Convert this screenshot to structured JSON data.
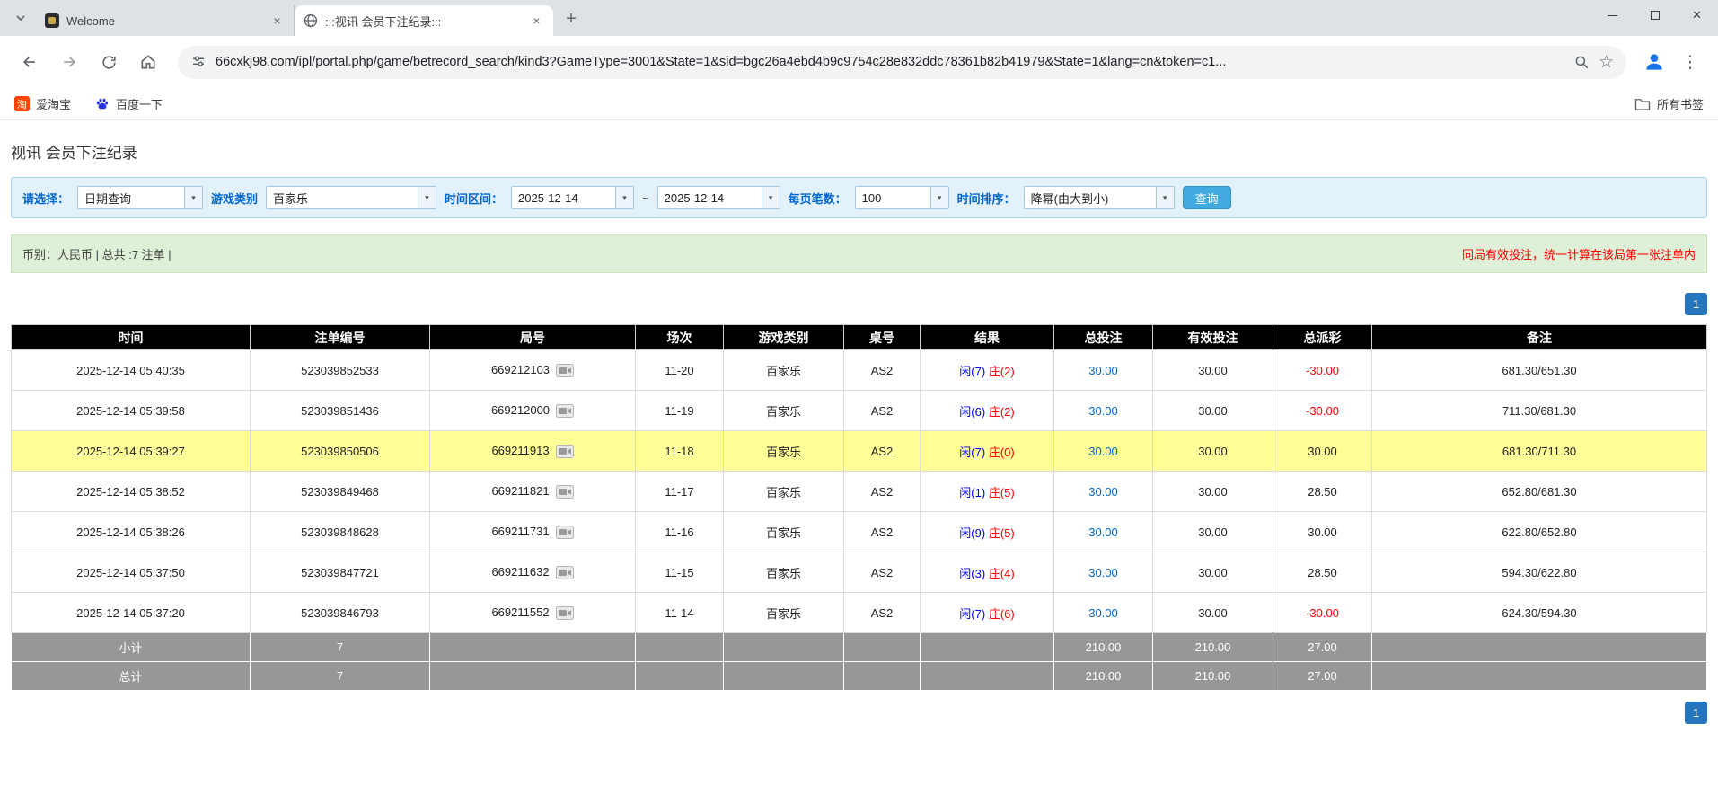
{
  "colors": {
    "accent_blue": "#0066cc",
    "negative_red": "#ff0000",
    "highlight_yellow": "#ffff99",
    "player_blue": "#0000ff",
    "banker_red": "#ff0000"
  },
  "icons": {
    "star": "☆",
    "menu": "⋮",
    "new_tab": "+",
    "close": "×",
    "window_close": "✕",
    "dropdown_arrow": "▾",
    "taobao_glyph": "淘"
  },
  "browser": {
    "tabs": [
      {
        "title": "Welcome"
      },
      {
        "title": ":::视讯 会员下注纪录:::"
      }
    ],
    "url": "66cxkj98.com/ipl/portal.php/game/betrecord_search/kind3?GameType=3001&State=1&sid=bgc26a4ebd4b9c9754c28e832ddc78361b82b41979&State=1&lang=cn&token=c1...",
    "bookmarks": [
      {
        "label": "爱淘宝"
      },
      {
        "label": "百度一下"
      }
    ],
    "all_bookmarks_label": "所有书签"
  },
  "page": {
    "title": "视讯 会员下注纪录",
    "filters": {
      "select_label": "请选择：",
      "select_value": "日期查询",
      "game_type_label": "游戏类别",
      "game_type_value": "百家乐",
      "date_range_label": "时间区间：",
      "date_from": "2025-12-14",
      "date_separator": "~",
      "date_to": "2025-12-14",
      "page_size_label": "每页笔数：",
      "page_size_value": "100",
      "sort_label": "时间排序：",
      "sort_value": "降幂(由大到小)",
      "search_button": "查询"
    },
    "info_bar": {
      "left": "币别：人民币 | 总共 :7 注单 |",
      "right": "同局有效投注，统一计算在该局第一张注单内"
    },
    "pagination": "1",
    "table": {
      "headers": [
        "时间",
        "注单编号",
        "局号",
        "场次",
        "游戏类别",
        "桌号",
        "结果",
        "总投注",
        "有效投注",
        "总派彩",
        "备注"
      ],
      "rows": [
        {
          "time": "2025-12-14 05:40:35",
          "bet_id": "523039852533",
          "round": "669212103",
          "session": "11-20",
          "game": "百家乐",
          "table_no": "AS2",
          "result_player": "闲(7)",
          "result_banker": "庄(2)",
          "total_bet": "30.00",
          "valid_bet": "30.00",
          "payout": "-30.00",
          "remark": "681.30/651.30",
          "highlighted": false
        },
        {
          "time": "2025-12-14 05:39:58",
          "bet_id": "523039851436",
          "round": "669212000",
          "session": "11-19",
          "game": "百家乐",
          "table_no": "AS2",
          "result_player": "闲(6)",
          "result_banker": "庄(2)",
          "total_bet": "30.00",
          "valid_bet": "30.00",
          "payout": "-30.00",
          "remark": "711.30/681.30",
          "highlighted": false
        },
        {
          "time": "2025-12-14 05:39:27",
          "bet_id": "523039850506",
          "round": "669211913",
          "session": "11-18",
          "game": "百家乐",
          "table_no": "AS2",
          "result_player": "闲(7)",
          "result_banker": "庄(0)",
          "total_bet": "30.00",
          "valid_bet": "30.00",
          "payout": "30.00",
          "remark": "681.30/711.30",
          "highlighted": true
        },
        {
          "time": "2025-12-14 05:38:52",
          "bet_id": "523039849468",
          "round": "669211821",
          "session": "11-17",
          "game": "百家乐",
          "table_no": "AS2",
          "result_player": "闲(1)",
          "result_banker": "庄(5)",
          "total_bet": "30.00",
          "valid_bet": "30.00",
          "payout": "28.50",
          "remark": "652.80/681.30",
          "highlighted": false
        },
        {
          "time": "2025-12-14 05:38:26",
          "bet_id": "523039848628",
          "round": "669211731",
          "session": "11-16",
          "game": "百家乐",
          "table_no": "AS2",
          "result_player": "闲(9)",
          "result_banker": "庄(5)",
          "total_bet": "30.00",
          "valid_bet": "30.00",
          "payout": "30.00",
          "remark": "622.80/652.80",
          "highlighted": false
        },
        {
          "time": "2025-12-14 05:37:50",
          "bet_id": "523039847721",
          "round": "669211632",
          "session": "11-15",
          "game": "百家乐",
          "table_no": "AS2",
          "result_player": "闲(3)",
          "result_banker": "庄(4)",
          "total_bet": "30.00",
          "valid_bet": "30.00",
          "payout": "28.50",
          "remark": "594.30/622.80",
          "highlighted": false
        },
        {
          "time": "2025-12-14 05:37:20",
          "bet_id": "523039846793",
          "round": "669211552",
          "session": "11-14",
          "game": "百家乐",
          "table_no": "AS2",
          "result_player": "闲(7)",
          "result_banker": "庄(6)",
          "total_bet": "30.00",
          "valid_bet": "30.00",
          "payout": "-30.00",
          "remark": "624.30/594.30",
          "highlighted": false
        }
      ],
      "subtotal": {
        "label": "小计",
        "count": "7",
        "total_bet": "210.00",
        "valid_bet": "210.00",
        "payout": "27.00"
      },
      "total": {
        "label": "总计",
        "count": "7",
        "total_bet": "210.00",
        "valid_bet": "210.00",
        "payout": "27.00"
      }
    }
  }
}
